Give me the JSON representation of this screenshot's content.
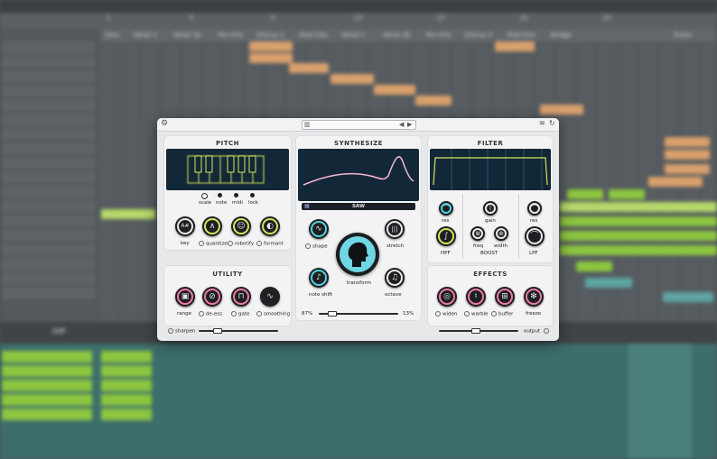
{
  "daw": {
    "ruler_ticks": [
      "1",
      "5",
      "9",
      "13",
      "17",
      "21",
      "25"
    ],
    "markers": [
      "Intro",
      "Verse 1",
      "Verse 1b",
      "Pre-Cho",
      "Chorus 1",
      "Post-Cho",
      "Verse 2",
      "Verse 2b",
      "Pre-Cho",
      "Chorus 2",
      "Post-Cho",
      "Bridge",
      "Outro"
    ],
    "lower_bar_label": "Diff"
  },
  "plugin": {
    "preset_prev": "◀",
    "preset_next": "▶",
    "pitch": {
      "title": "PITCH",
      "keyboard_dots": [
        "scale",
        "note",
        "midi",
        "lock"
      ],
      "knobs": [
        {
          "label": "key",
          "glyph": "A#",
          "accent": "white"
        },
        {
          "label": "quantize",
          "glyph": "∧",
          "accent": "yellow"
        },
        {
          "label": "robotify",
          "glyph": "☺",
          "accent": "yellow"
        },
        {
          "label": "formant",
          "glyph": "◐",
          "accent": "yellow"
        }
      ]
    },
    "utility": {
      "title": "UTILITY",
      "knobs": [
        {
          "label": "range",
          "glyph": "▣"
        },
        {
          "label": "de-ess",
          "glyph": "⊘"
        },
        {
          "label": "gate",
          "glyph": "⊓"
        },
        {
          "label": "smoothing",
          "glyph": "∿"
        }
      ],
      "slider_label": "sharpen",
      "slider_value": 0.2
    },
    "synthesize": {
      "title": "SYNTHESIZE",
      "waveform_label": "SAW",
      "knobs": [
        {
          "label": "shape",
          "glyph": "∿"
        },
        {
          "label": "stretch",
          "glyph": "|||"
        },
        {
          "label": "note shift",
          "glyph": "♪"
        },
        {
          "label": "octave",
          "glyph": "♫"
        }
      ],
      "center_label": "transform",
      "mix_left": "87%",
      "mix_right": "13%",
      "mix_value": 0.13
    },
    "filter": {
      "title": "FILTER",
      "knobs": [
        {
          "label": "res",
          "glyph": "⌒"
        },
        {
          "label": "gain",
          "glyph": "⌇"
        },
        {
          "label": "res",
          "glyph": "⌒"
        },
        {
          "label": "freq",
          "glyph": "⋓"
        },
        {
          "label": "width",
          "glyph": "⊕"
        },
        {
          "label": "HPF",
          "glyph": "∫"
        },
        {
          "label": "LPF",
          "glyph": "⌒"
        }
      ],
      "group_label": "BOOST"
    },
    "effects": {
      "title": "EFFECTS",
      "knobs": [
        {
          "label": "widen",
          "glyph": "◎"
        },
        {
          "label": "warble",
          "glyph": "♮"
        },
        {
          "label": "buffer",
          "glyph": "⊞"
        },
        {
          "label": "freeze",
          "glyph": "✻"
        }
      ],
      "slider_label": "output",
      "slider_value": 0.45
    }
  },
  "colors": {
    "accent_yellow": "#d7e35a",
    "accent_cyan": "#4fd3e0",
    "accent_pink": "#f07aa8",
    "screen_bg": "#122838",
    "clip_orange": "#d9a06c",
    "clip_green": "#8cc63f"
  }
}
